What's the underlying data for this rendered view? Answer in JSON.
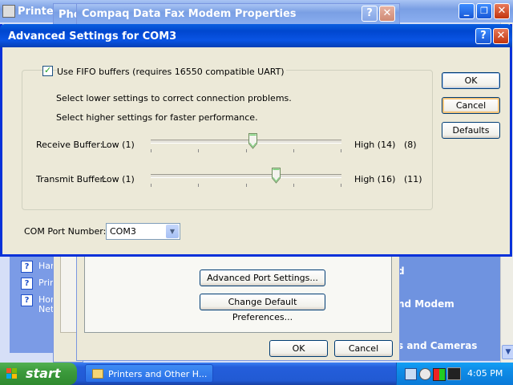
{
  "desktop": {
    "explorer_title": "Printer",
    "side_links": [
      "Har",
      "Prin",
      "Hon",
      "Net"
    ],
    "right_fragments": [
      "d",
      "nd Modem",
      "s and Cameras"
    ]
  },
  "phone_window": {
    "title": "Pho"
  },
  "modem_properties": {
    "title": "Compaq Data Fax Modem Properties",
    "help_icon": "?",
    "close_icon": "✕",
    "advanced_port_button": "Advanced Port Settings...",
    "change_prefs_button": "Change Default Preferences...",
    "ok_button": "OK",
    "cancel_button": "Cancel"
  },
  "advanced_dialog": {
    "title": "Advanced Settings for COM3",
    "help_icon": "?",
    "close_icon": "✕",
    "fifo_checkbox_label": "Use FIFO buffers (requires 16550 compatible UART)",
    "fifo_checked": true,
    "hint_lower": "Select lower settings to correct connection problems.",
    "hint_higher": "Select higher settings for faster performance.",
    "receive": {
      "label": "Receive Buffer:",
      "low": "Low (1)",
      "high": "High (14)",
      "value_text": "(8)",
      "value": 8,
      "min": 1,
      "max": 14
    },
    "transmit": {
      "label": "Transmit Buffer:",
      "low": "Low (1)",
      "high": "High (16)",
      "value_text": "(11)",
      "value": 11,
      "min": 1,
      "max": 16
    },
    "com_port_label": "COM Port Number:",
    "com_port_value": "COM3",
    "ok_button": "OK",
    "cancel_button": "Cancel",
    "defaults_button": "Defaults"
  },
  "taskbar": {
    "start_label": "start",
    "task_button": "Printers and Other H...",
    "clock": "4:05 PM"
  },
  "colors": {
    "xp_blue": "#0054e3",
    "taskbar_blue": "#245edb",
    "start_green": "#3c9a3c",
    "tray_blue": "#0f8ee9"
  }
}
